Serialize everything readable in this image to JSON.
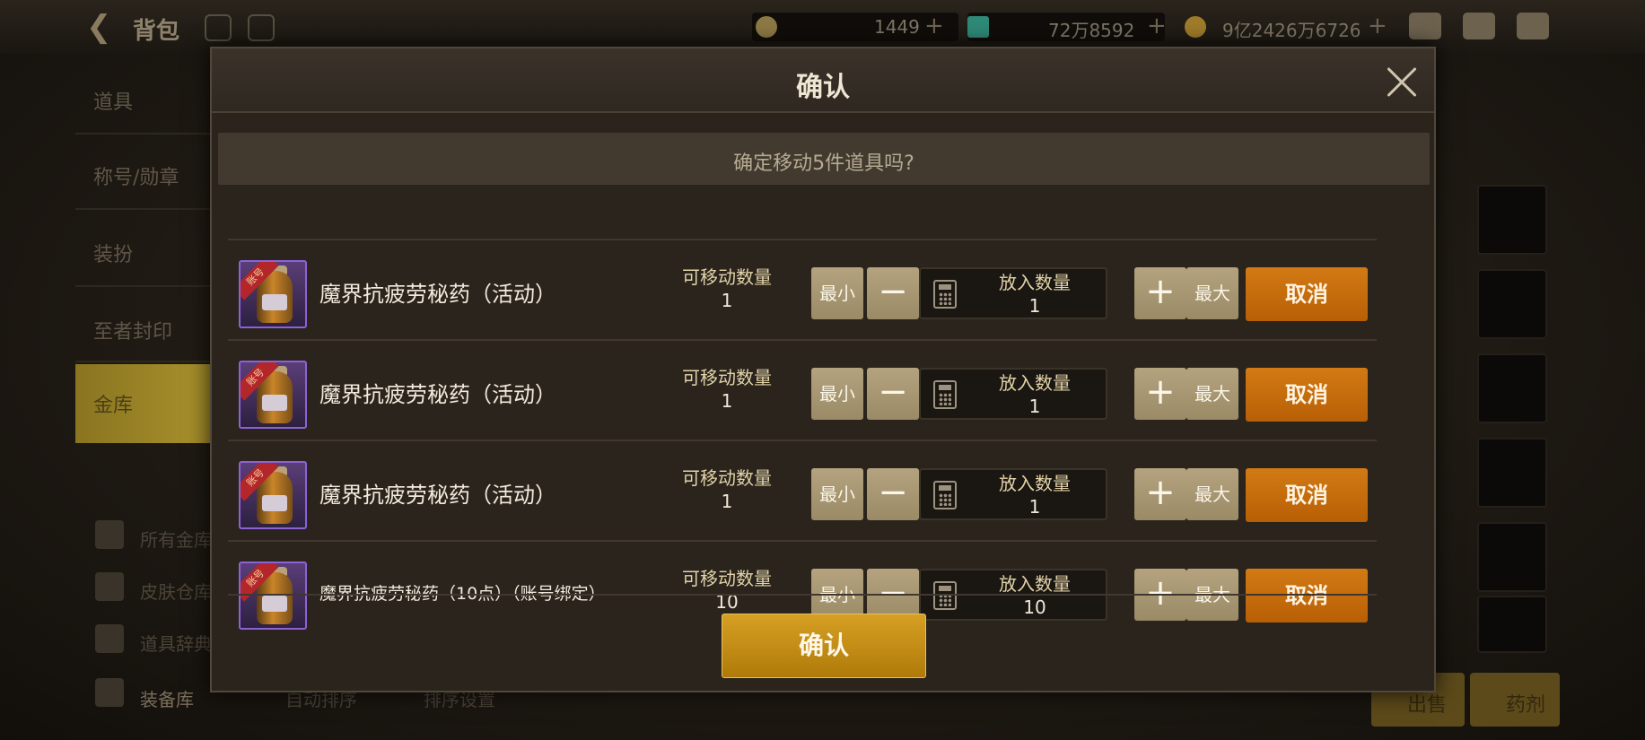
{
  "background": {
    "title": "背包",
    "currencies": [
      {
        "name": "gold-coin-c",
        "value": "1449",
        "color": "#c9a24a"
      },
      {
        "name": "crystal",
        "value": "72万8592",
        "color": "#3fc0a8"
      },
      {
        "name": "gold",
        "value": "9亿2426万6726",
        "color": "#d4a438"
      }
    ],
    "sidebar": [
      "道具",
      "称号/勋章",
      "装扮",
      "至者封印",
      "金库"
    ],
    "sub_items": [
      "所有金库",
      "皮肤仓库",
      "道具辞典",
      "装备库"
    ],
    "bottom_links": [
      "自动排序",
      "排序设置"
    ],
    "bottom_buttons": [
      "出售",
      "药剂"
    ]
  },
  "dialog": {
    "title": "确认",
    "question": "确定移动5件道具吗?",
    "tag": "账号",
    "labels": {
      "movable": "可移动数量",
      "put_in": "放入数量",
      "min": "最小",
      "max": "最大",
      "minus": "−",
      "plus": "+",
      "cancel": "取消"
    },
    "items": [
      {
        "name": "魔界抗疲劳秘药（活动）",
        "movable": "1",
        "quantity": "1"
      },
      {
        "name": "魔界抗疲劳秘药（活动）",
        "movable": "1",
        "quantity": "1"
      },
      {
        "name": "魔界抗疲劳秘药（活动）",
        "movable": "1",
        "quantity": "1"
      },
      {
        "name": "魔界抗疲劳秘药（10点）（账号绑定）",
        "movable": "10",
        "quantity": "10"
      }
    ],
    "confirm_label": "确认"
  },
  "colors": {
    "accent_orange": "#c46a0c",
    "confirm_gold": "#c68e16",
    "button_tan": "#a8976f",
    "item_border_purple": "#8d62d6"
  }
}
